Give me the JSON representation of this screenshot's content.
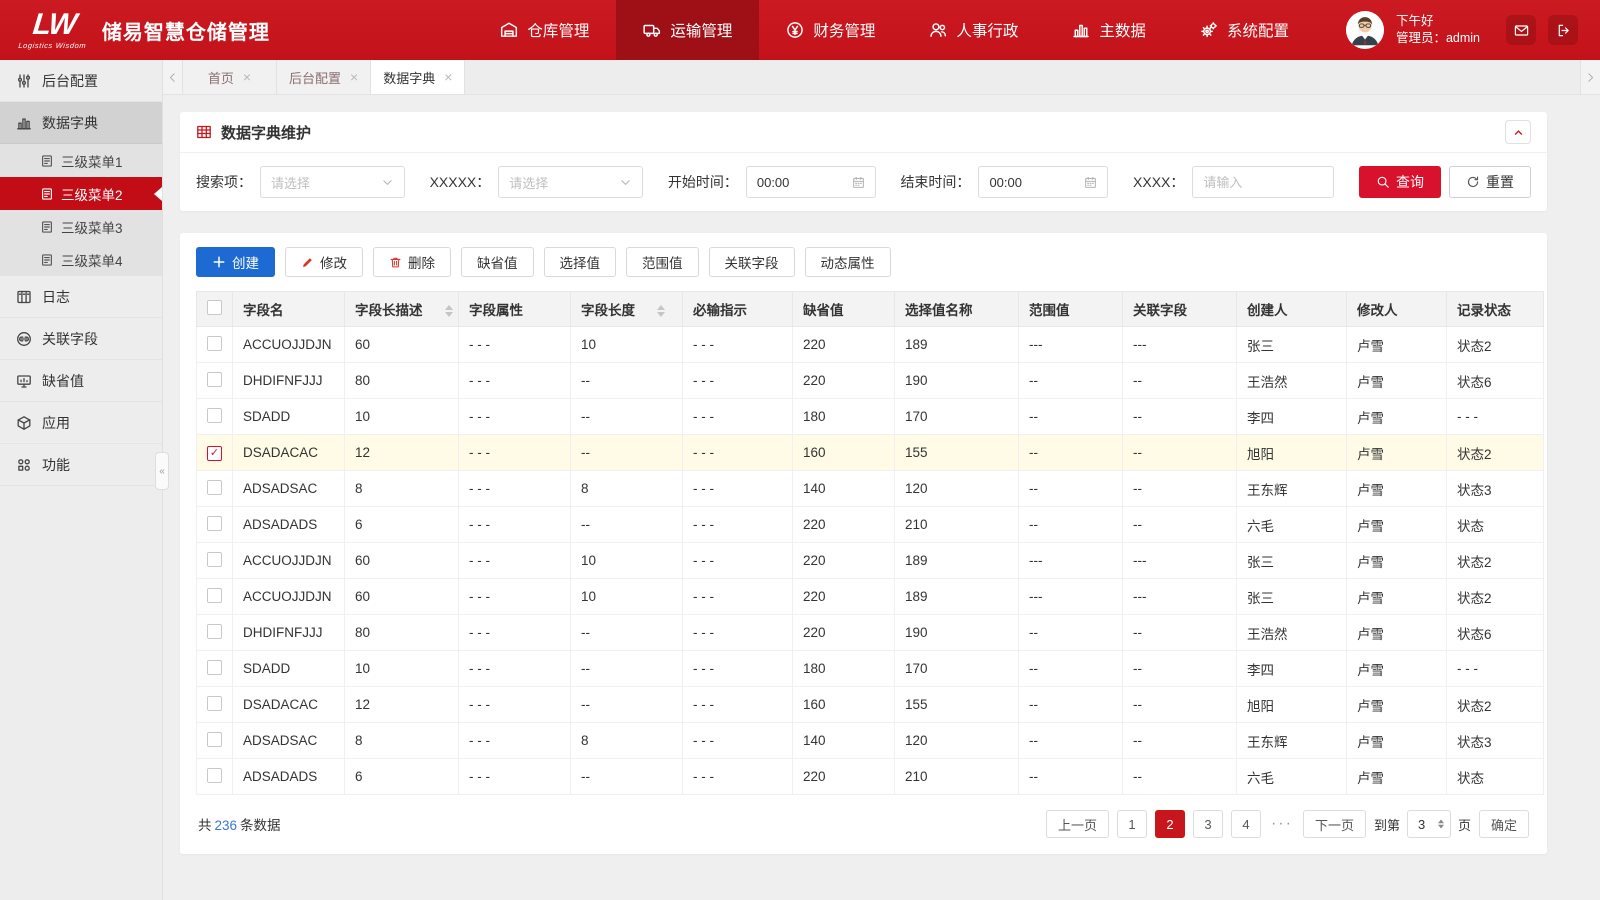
{
  "brand": {
    "logo_text": "LW",
    "logo_subtext": "Logistics Wisdom",
    "app_title": "储易智慧仓储管理"
  },
  "header": {
    "nav": [
      {
        "label": "仓库管理",
        "icon": "warehouse-icon",
        "active": false
      },
      {
        "label": "运输管理",
        "icon": "truck-icon",
        "active": true
      },
      {
        "label": "财务管理",
        "icon": "finance-icon",
        "active": false
      },
      {
        "label": "人事行政",
        "icon": "hr-icon",
        "active": false
      },
      {
        "label": "主数据",
        "icon": "bar-chart-icon",
        "active": false
      },
      {
        "label": "系统配置",
        "icon": "gear-icon",
        "active": false
      }
    ],
    "greeting": "下午好",
    "user": "管理员：admin"
  },
  "sidebar": {
    "items": [
      {
        "label": "后台配置",
        "icon": "sliders-icon",
        "active": false
      },
      {
        "label": "数据字典",
        "icon": "chart-icon",
        "active": true,
        "children": [
          {
            "label": "三级菜单1",
            "active": false
          },
          {
            "label": "三级菜单2",
            "active": true
          },
          {
            "label": "三级菜单3",
            "active": false
          },
          {
            "label": "三级菜单4",
            "active": false
          }
        ]
      },
      {
        "label": "日志",
        "icon": "log-icon",
        "active": false
      },
      {
        "label": "关联字段",
        "icon": "link-icon",
        "active": false
      },
      {
        "label": "缺省值",
        "icon": "monitor-icon",
        "active": false
      },
      {
        "label": "应用",
        "icon": "cube-icon",
        "active": false
      },
      {
        "label": "功能",
        "icon": "apps-icon",
        "active": false
      }
    ]
  },
  "tabs": [
    {
      "label": "首页",
      "active": false
    },
    {
      "label": "后台配置",
      "active": false
    },
    {
      "label": "数据字典",
      "active": true
    }
  ],
  "panel": {
    "title": "数据字典维护"
  },
  "filters": {
    "search_label": "搜索项：",
    "search_placeholder": "请选择",
    "xxxxx_label": "XXXXX：",
    "xxxxx_placeholder": "请选择",
    "start_label": "开始时间：",
    "start_value": "00:00",
    "end_label": "结束时间：",
    "end_value": "00:00",
    "xxxx_label": "XXXX：",
    "xxxx_placeholder": "请输入",
    "query_label": "查询",
    "reset_label": "重置"
  },
  "actions": [
    {
      "label": "创建",
      "icon": "plus-icon",
      "style": "primary"
    },
    {
      "label": "修改",
      "icon": "pencil-icon",
      "style": "outline"
    },
    {
      "label": "删除",
      "icon": "trash-icon",
      "style": "outline"
    },
    {
      "label": "缺省值",
      "style": "outline"
    },
    {
      "label": "选择值",
      "style": "outline"
    },
    {
      "label": "范围值",
      "style": "outline"
    },
    {
      "label": "关联字段",
      "style": "outline"
    },
    {
      "label": "动态属性",
      "style": "outline"
    }
  ],
  "table": {
    "columns": [
      "字段名",
      "字段长描述",
      "字段属性",
      "字段长度",
      "必输指示",
      "缺省值",
      "选择值名称",
      "范围值",
      "关联字段",
      "创建人",
      "修改人",
      "记录状态"
    ],
    "sortable": [
      1,
      3
    ],
    "rows": [
      {
        "checked": false,
        "cells": [
          "ACCUOJJDJN",
          "60",
          "- - -",
          "10",
          "- - -",
          "220",
          "189",
          "---",
          "---",
          "张三",
          "卢雪",
          "状态2"
        ]
      },
      {
        "checked": false,
        "cells": [
          "DHDIFNFJJJ",
          "80",
          "- - -",
          "--",
          "- - -",
          "220",
          "190",
          "--",
          "--",
          "王浩然",
          "卢雪",
          "状态6"
        ]
      },
      {
        "checked": false,
        "cells": [
          "SDADD",
          "10",
          "- - -",
          "--",
          "- - -",
          "180",
          "170",
          "--",
          "--",
          "李四",
          "卢雪",
          "- - -"
        ]
      },
      {
        "checked": true,
        "cells": [
          "DSADACAC",
          "12",
          "- - -",
          "--",
          "- - -",
          "160",
          "155",
          "--",
          "--",
          "旭阳",
          "卢雪",
          "状态2"
        ]
      },
      {
        "checked": false,
        "cells": [
          "ADSADSAC",
          "8",
          "- - -",
          "8",
          "- - -",
          "140",
          "120",
          "--",
          "--",
          "王东辉",
          "卢雪",
          "状态3"
        ]
      },
      {
        "checked": false,
        "cells": [
          "ADSADADS",
          "6",
          "- - -",
          "--",
          "- - -",
          "220",
          "210",
          "--",
          "--",
          "六毛",
          "卢雪",
          "状态"
        ]
      },
      {
        "checked": false,
        "cells": [
          "ACCUOJJDJN",
          "60",
          "- - -",
          "10",
          "- - -",
          "220",
          "189",
          "---",
          "---",
          "张三",
          "卢雪",
          "状态2"
        ]
      },
      {
        "checked": false,
        "cells": [
          "ACCUOJJDJN",
          "60",
          "- - -",
          "10",
          "- - -",
          "220",
          "189",
          "---",
          "---",
          "张三",
          "卢雪",
          "状态2"
        ]
      },
      {
        "checked": false,
        "cells": [
          "DHDIFNFJJJ",
          "80",
          "- - -",
          "--",
          "- - -",
          "220",
          "190",
          "--",
          "--",
          "王浩然",
          "卢雪",
          "状态6"
        ]
      },
      {
        "checked": false,
        "cells": [
          "SDADD",
          "10",
          "- - -",
          "--",
          "- - -",
          "180",
          "170",
          "--",
          "--",
          "李四",
          "卢雪",
          "- - -"
        ]
      },
      {
        "checked": false,
        "cells": [
          "DSADACAC",
          "12",
          "- - -",
          "--",
          "- - -",
          "160",
          "155",
          "--",
          "--",
          "旭阳",
          "卢雪",
          "状态2"
        ]
      },
      {
        "checked": false,
        "cells": [
          "ADSADSAC",
          "8",
          "- - -",
          "8",
          "- - -",
          "140",
          "120",
          "--",
          "--",
          "王东辉",
          "卢雪",
          "状态3"
        ]
      },
      {
        "checked": false,
        "cells": [
          "ADSADADS",
          "6",
          "- - -",
          "--",
          "- - -",
          "220",
          "210",
          "--",
          "--",
          "六毛",
          "卢雪",
          "状态"
        ]
      }
    ]
  },
  "footer": {
    "total_prefix": "共",
    "total_count": "236",
    "total_suffix": "条数据",
    "pagination": {
      "prev": "上一页",
      "pages": [
        "1",
        "2",
        "3",
        "4"
      ],
      "active_page": "2",
      "ellipsis": "···",
      "next": "下一页",
      "goto_prefix": "到第",
      "goto_value": "3",
      "goto_suffix": "页",
      "confirm": "确定"
    }
  },
  "colors": {
    "header_red": "#c8161d",
    "nav_active_red": "#9e1016",
    "submenu_active_red": "#c20d16",
    "query_red": "#d8122d",
    "primary_blue": "#1e6ad3",
    "selected_row_yellow": "#fffbe6",
    "count_blue": "#3a77d2"
  }
}
